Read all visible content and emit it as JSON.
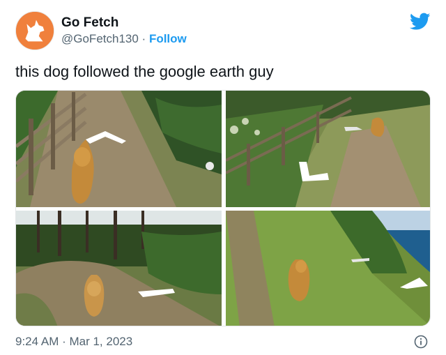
{
  "account": {
    "name": "Go Fetch",
    "handle": "@GoFetch130",
    "separator": " · ",
    "follow_label": "Follow"
  },
  "tweet": {
    "text": "this dog followed the google earth guy",
    "timestamp": "9:24 AM · Mar 1, 2023"
  },
  "icons": {
    "brand": "twitter-bird-icon",
    "info": "info-icon",
    "avatar": "dog-logo-icon"
  },
  "colors": {
    "accent": "#1d9bf0",
    "avatar_bg": "#f0803c",
    "muted_text": "#536471"
  }
}
